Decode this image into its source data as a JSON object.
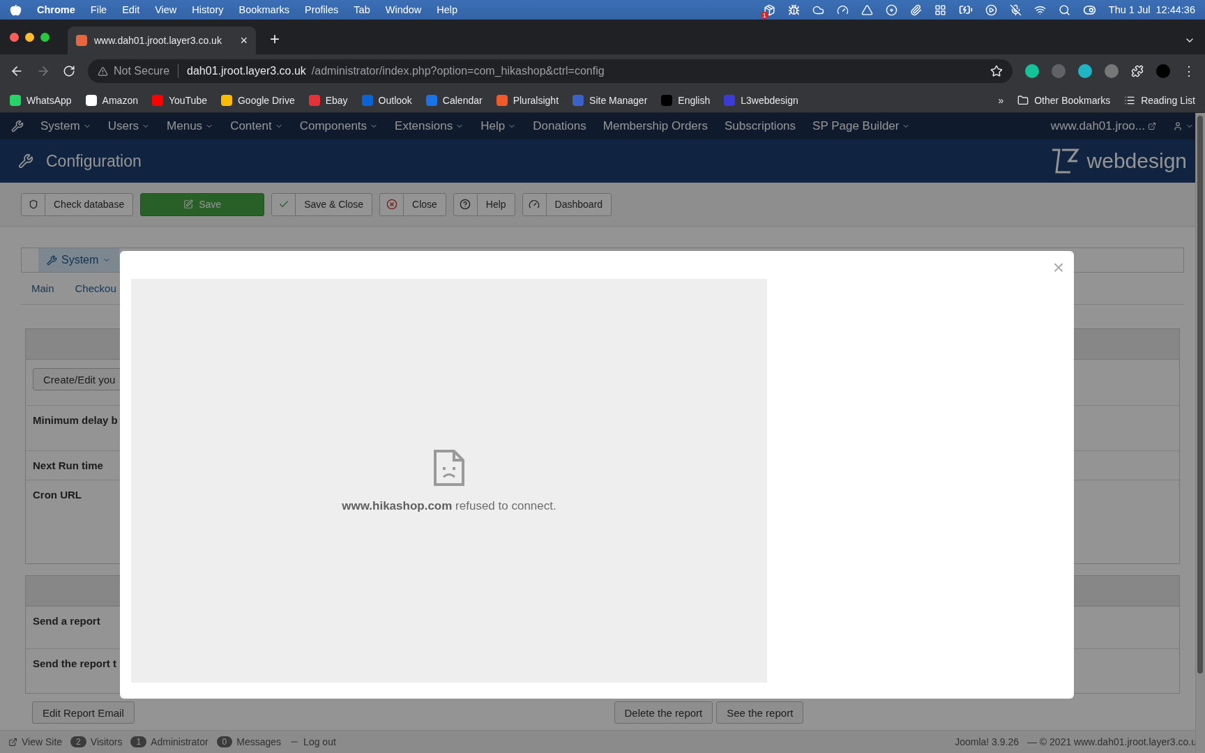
{
  "mac_menu": {
    "items": [
      {
        "label": "Chrome",
        "app": true
      },
      {
        "label": "File",
        "app": false
      },
      {
        "label": "Edit",
        "app": false
      },
      {
        "label": "View",
        "app": false
      },
      {
        "label": "History",
        "app": false
      },
      {
        "label": "Bookmarks",
        "app": false
      },
      {
        "label": "Profiles",
        "app": false
      },
      {
        "label": "Tab",
        "app": false
      },
      {
        "label": "Window",
        "app": false
      },
      {
        "label": "Help",
        "app": false
      }
    ],
    "notification_badge": "1",
    "clock": "Thu 1 Jul  12:44:36"
  },
  "browser": {
    "tab_title": "www.dah01.jroot.layer3.co.uk",
    "tab_close": "×",
    "new_tab": "+",
    "security": "Not Secure",
    "url_host": "dah01.jroot.layer3.co.uk",
    "url_path": "/administrator/index.php?option=com_hikashop&ctrl=config",
    "bookmarks": [
      {
        "label": "WhatsApp",
        "color": "#25d366"
      },
      {
        "label": "Amazon",
        "color": "#ffffff"
      },
      {
        "label": "YouTube",
        "color": "#ff0000"
      },
      {
        "label": "Google Drive",
        "color": "#fbbc04"
      },
      {
        "label": "Ebay",
        "color": "#e53238"
      },
      {
        "label": "Outlook",
        "color": "#0a64d6"
      },
      {
        "label": "Calendar",
        "color": "#1a73e8"
      },
      {
        "label": "Pluralsight",
        "color": "#f15b2a"
      },
      {
        "label": "Site Manager",
        "color": "#3a62c9"
      },
      {
        "label": "English",
        "color": "#000000"
      },
      {
        "label": "L3webdesign",
        "color": "#3b3bd6"
      }
    ],
    "more_bookmarks": "»",
    "other_bookmarks": "Other Bookmarks",
    "reading_list": "Reading List",
    "menu_button": "⋮"
  },
  "admin_nav": {
    "items": [
      {
        "label": "System",
        "dropdown": true
      },
      {
        "label": "Users",
        "dropdown": true
      },
      {
        "label": "Menus",
        "dropdown": true
      },
      {
        "label": "Content",
        "dropdown": true
      },
      {
        "label": "Components",
        "dropdown": true
      },
      {
        "label": "Extensions",
        "dropdown": true
      },
      {
        "label": "Help",
        "dropdown": true
      },
      {
        "label": "Donations",
        "dropdown": false
      },
      {
        "label": "Membership Orders",
        "dropdown": false
      },
      {
        "label": "Subscriptions",
        "dropdown": false
      },
      {
        "label": "SP Page Builder",
        "dropdown": true
      }
    ],
    "site_link": "www.dah01.jroo..."
  },
  "header": {
    "title": "Configuration",
    "logo_text": "webdesign"
  },
  "toolbar": [
    {
      "label": "Check database",
      "kind": "shield"
    },
    {
      "label": "Save",
      "kind": "primary"
    },
    {
      "label": "Save & Close",
      "kind": "check"
    },
    {
      "label": "Close",
      "kind": "close"
    },
    {
      "label": "Help",
      "kind": "help"
    },
    {
      "label": "Dashboard",
      "kind": "dashboard"
    }
  ],
  "config": {
    "menu_tab": "System",
    "tabs": [
      "Main",
      "Checkou"
    ],
    "left_panels": [
      {
        "rows": [
          {
            "kind": "button",
            "text": "Create/Edit you"
          },
          {
            "kind": "label",
            "text": "Minimum delay b"
          },
          {
            "kind": "label",
            "text": "Next Run time"
          },
          {
            "kind": "label",
            "text": "Cron URL"
          }
        ]
      },
      {
        "rows": [
          {
            "kind": "label",
            "text": "Send a report"
          },
          {
            "kind": "label",
            "text": "Send the report t"
          }
        ]
      }
    ],
    "left_buttons": [
      "Edit Report Email"
    ],
    "right_buttons": [
      "Delete the report",
      "See the report"
    ]
  },
  "modal": {
    "close": "×",
    "message": "**www.hikashop.com** refused to connect."
  },
  "status_bar": {
    "view_site": "View Site",
    "counters": [
      {
        "count": "2",
        "label": "Visitors"
      },
      {
        "count": "1",
        "label": "Administrator"
      },
      {
        "count": "0",
        "label": "Messages"
      }
    ],
    "logout": "Log out",
    "version": "Joomla! 3.9.26",
    "copyright": "—  © 2021 www.dah01.jroot.layer3.co.u"
  }
}
